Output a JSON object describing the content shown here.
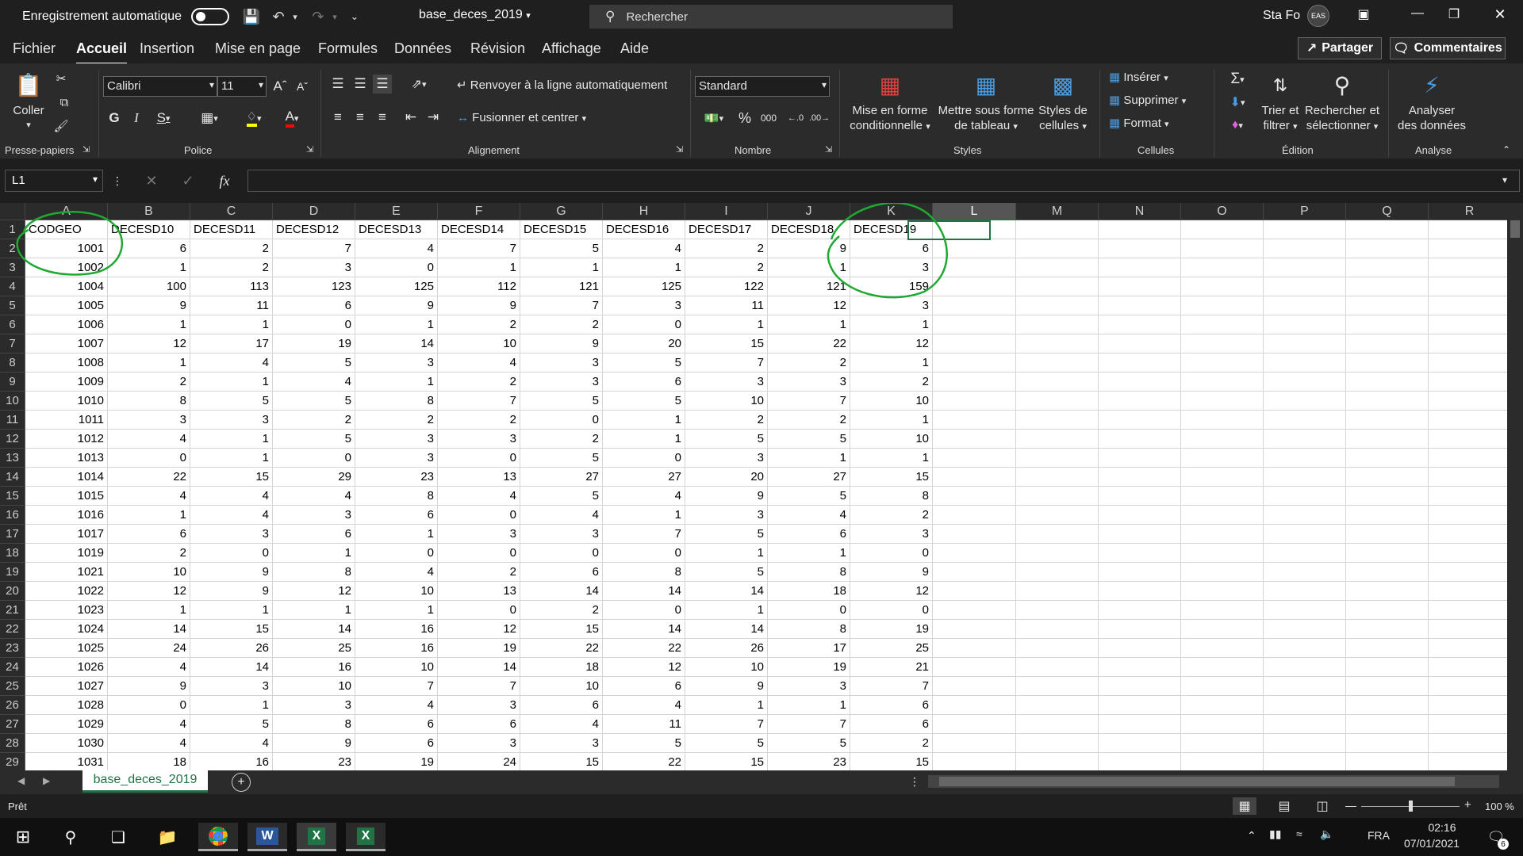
{
  "titlebar": {
    "autosave_label": "Enregistrement automatique",
    "filename": "base_deces_2019",
    "search_placeholder": "Rechercher",
    "user_name": "Sta Fo",
    "avatar_text": "EAS"
  },
  "menu": [
    "Fichier",
    "Accueil",
    "Insertion",
    "Mise en page",
    "Formules",
    "Données",
    "Révision",
    "Affichage",
    "Aide"
  ],
  "menu_active": "Accueil",
  "share_label": "Partager",
  "comments_label": "Commentaires",
  "ribbon": {
    "clipboard": {
      "paste_label": "Coller",
      "group": "Presse-papiers"
    },
    "font": {
      "name": "Calibri",
      "size": "11",
      "group": "Police"
    },
    "alignment": {
      "wrap_label": "Renvoyer à la ligne automatiquement",
      "merge_label": "Fusionner et centrer",
      "group": "Alignement"
    },
    "number": {
      "format": "Standard",
      "group": "Nombre"
    },
    "styles": {
      "cond_line1": "Mise en forme",
      "cond_line2": "conditionnelle",
      "table_line1": "Mettre sous forme",
      "table_line2": "de tableau",
      "cell_line1": "Styles de",
      "cell_line2": "cellules",
      "group": "Styles"
    },
    "cells": {
      "insert": "Insérer",
      "delete": "Supprimer",
      "format": "Format",
      "group": "Cellules"
    },
    "editing": {
      "sort_line1": "Trier et",
      "sort_line2": "filtrer",
      "find_line1": "Rechercher et",
      "find_line2": "sélectionner",
      "group": "Édition"
    },
    "analysis": {
      "line1": "Analyser",
      "line2": "des données",
      "group": "Analyse"
    }
  },
  "formula": {
    "namebox": "L1",
    "content": ""
  },
  "columns": [
    "A",
    "B",
    "C",
    "D",
    "E",
    "F",
    "G",
    "H",
    "I",
    "J",
    "K",
    "L",
    "M",
    "N",
    "O",
    "P",
    "Q",
    "R"
  ],
  "selected_column": "L",
  "headers": [
    "CODGEO",
    "DECESD10",
    "DECESD11",
    "DECESD12",
    "DECESD13",
    "DECESD14",
    "DECESD15",
    "DECESD16",
    "DECESD17",
    "DECESD18",
    "DECESD19"
  ],
  "rows": [
    [
      "1001",
      "6",
      "2",
      "7",
      "4",
      "7",
      "5",
      "4",
      "2",
      "9",
      "6"
    ],
    [
      "1002",
      "1",
      "2",
      "3",
      "0",
      "1",
      "1",
      "1",
      "2",
      "1",
      "3"
    ],
    [
      "1004",
      "100",
      "113",
      "123",
      "125",
      "112",
      "121",
      "125",
      "122",
      "121",
      "159"
    ],
    [
      "1005",
      "9",
      "11",
      "6",
      "9",
      "9",
      "7",
      "3",
      "11",
      "12",
      "3"
    ],
    [
      "1006",
      "1",
      "1",
      "0",
      "1",
      "2",
      "2",
      "0",
      "1",
      "1",
      "1"
    ],
    [
      "1007",
      "12",
      "17",
      "19",
      "14",
      "10",
      "9",
      "20",
      "15",
      "22",
      "12"
    ],
    [
      "1008",
      "1",
      "4",
      "5",
      "3",
      "4",
      "3",
      "5",
      "7",
      "2",
      "1"
    ],
    [
      "1009",
      "2",
      "1",
      "4",
      "1",
      "2",
      "3",
      "6",
      "3",
      "3",
      "2"
    ],
    [
      "1010",
      "8",
      "5",
      "5",
      "8",
      "7",
      "5",
      "5",
      "10",
      "7",
      "10"
    ],
    [
      "1011",
      "3",
      "3",
      "2",
      "2",
      "2",
      "0",
      "1",
      "2",
      "2",
      "1"
    ],
    [
      "1012",
      "4",
      "1",
      "5",
      "3",
      "3",
      "2",
      "1",
      "5",
      "5",
      "10"
    ],
    [
      "1013",
      "0",
      "1",
      "0",
      "3",
      "0",
      "5",
      "0",
      "3",
      "1",
      "1"
    ],
    [
      "1014",
      "22",
      "15",
      "29",
      "23",
      "13",
      "27",
      "27",
      "20",
      "27",
      "15"
    ],
    [
      "1015",
      "4",
      "4",
      "4",
      "8",
      "4",
      "5",
      "4",
      "9",
      "5",
      "8"
    ],
    [
      "1016",
      "1",
      "4",
      "3",
      "6",
      "0",
      "4",
      "1",
      "3",
      "4",
      "2"
    ],
    [
      "1017",
      "6",
      "3",
      "6",
      "1",
      "3",
      "3",
      "7",
      "5",
      "6",
      "3"
    ],
    [
      "1019",
      "2",
      "0",
      "1",
      "0",
      "0",
      "0",
      "0",
      "1",
      "1",
      "0"
    ],
    [
      "1021",
      "10",
      "9",
      "8",
      "4",
      "2",
      "6",
      "8",
      "5",
      "8",
      "9"
    ],
    [
      "1022",
      "12",
      "9",
      "12",
      "10",
      "13",
      "14",
      "14",
      "14",
      "18",
      "12"
    ],
    [
      "1023",
      "1",
      "1",
      "1",
      "1",
      "0",
      "2",
      "0",
      "1",
      "0",
      "0"
    ],
    [
      "1024",
      "14",
      "15",
      "14",
      "16",
      "12",
      "15",
      "14",
      "14",
      "8",
      "19"
    ],
    [
      "1025",
      "24",
      "26",
      "25",
      "16",
      "19",
      "22",
      "22",
      "26",
      "17",
      "25"
    ],
    [
      "1026",
      "4",
      "14",
      "16",
      "10",
      "14",
      "18",
      "12",
      "10",
      "19",
      "21"
    ],
    [
      "1027",
      "9",
      "3",
      "10",
      "7",
      "7",
      "10",
      "6",
      "9",
      "3",
      "7"
    ],
    [
      "1028",
      "0",
      "1",
      "3",
      "4",
      "3",
      "6",
      "4",
      "1",
      "1",
      "6"
    ],
    [
      "1029",
      "4",
      "5",
      "8",
      "6",
      "6",
      "4",
      "11",
      "7",
      "7",
      "6"
    ],
    [
      "1030",
      "4",
      "4",
      "9",
      "6",
      "3",
      "3",
      "5",
      "5",
      "5",
      "2"
    ],
    [
      "1031",
      "18",
      "16",
      "23",
      "19",
      "24",
      "15",
      "22",
      "15",
      "23",
      "15"
    ]
  ],
  "sheet_tab": "base_deces_2019",
  "status": {
    "ready": "Prêt",
    "zoom": "100 %"
  },
  "taskbar": {
    "lang": "FRA",
    "time": "02:16",
    "date": "07/01/2021",
    "notifications": "6"
  },
  "colors": {
    "accent": "#217346",
    "annotation": "#1fa832"
  }
}
